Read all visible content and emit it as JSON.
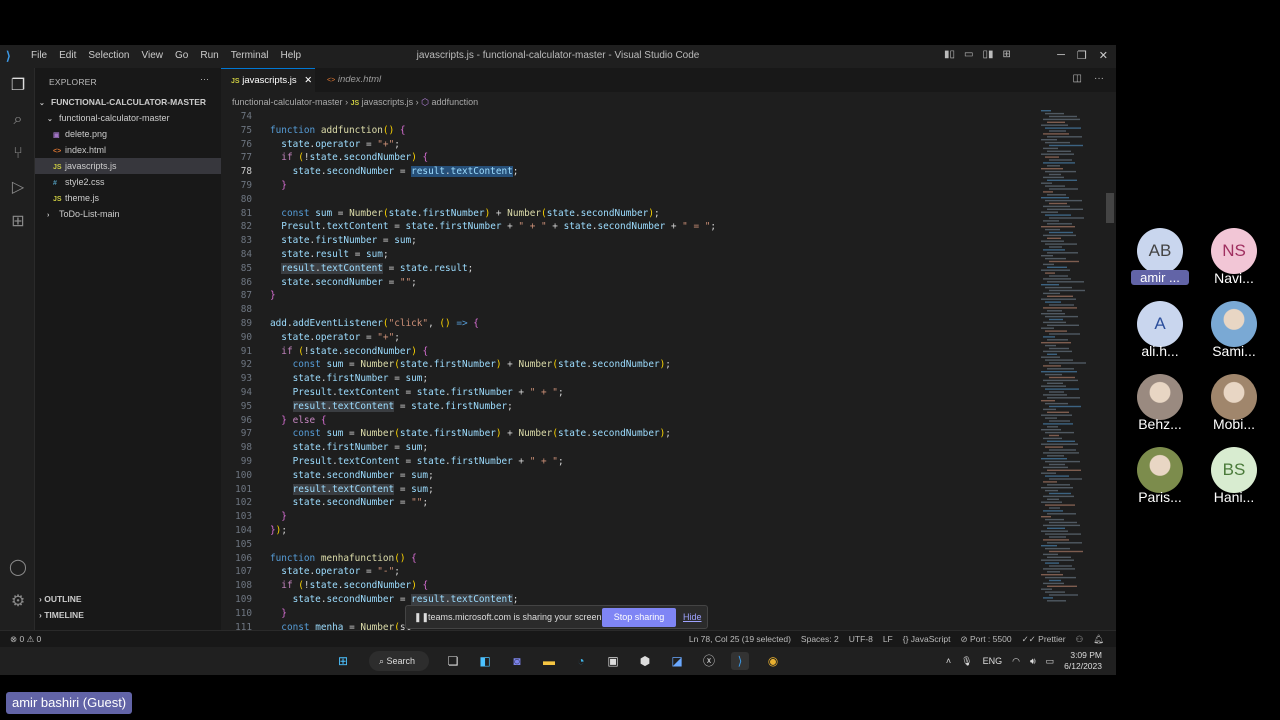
{
  "window": {
    "title": "javascripts.js - functional-calculator-master - Visual Studio Code",
    "menu": [
      "File",
      "Edit",
      "Selection",
      "View",
      "Go",
      "Run",
      "Terminal",
      "Help"
    ]
  },
  "explorer": {
    "header": "EXPLORER",
    "project": "FUNCTIONAL-CALCULATOR-MASTER",
    "folder": "functional-calculator-master",
    "files": [
      {
        "name": "delete.png",
        "type": "png",
        "badge": "▣"
      },
      {
        "name": "index.html",
        "type": "html",
        "badge": "<>"
      },
      {
        "name": "javascripts.js",
        "type": "js",
        "badge": "JS",
        "selected": true
      },
      {
        "name": "style2.css",
        "type": "css",
        "badge": "#"
      },
      {
        "name": "theme.js",
        "type": "js",
        "badge": "JS"
      }
    ],
    "other_folder": "ToDo-List-main",
    "outline": "OUTLINE",
    "timeline": "TIMELINE"
  },
  "tabs": [
    {
      "label": "javascripts.js",
      "badge": "JS",
      "active": true
    },
    {
      "label": "index.html",
      "badge": "<>",
      "active": false
    }
  ],
  "breadcrumb": {
    "folder": "functional-calculator-master",
    "file": "javascripts.js",
    "symbol": "addfunction"
  },
  "code": {
    "current_line": "78",
    "lines": [
      {
        "n": "74",
        "t": ""
      },
      {
        "n": "75",
        "t": "function addfunction() {"
      },
      {
        "n": "76",
        "t": "  state.operator = \"+\";"
      },
      {
        "n": "77",
        "t": "  if (!state.secondNumber) {"
      },
      {
        "n": "78",
        "t": "    state.secondNumber = result.textContent;"
      },
      {
        "n": "79",
        "t": "  }"
      },
      {
        "n": "80",
        "t": ""
      },
      {
        "n": "81",
        "t": "  const sum = Number(state.firstNumber) + Number(state.secondNumber);"
      },
      {
        "n": "82",
        "t": "  Presult.textContent = state.firstNumber + \" + \" + state.secondNumber + \" = \";"
      },
      {
        "n": "83",
        "t": "  state.firstNumber = sum;"
      },
      {
        "n": "84",
        "t": "  state.result = sum;"
      },
      {
        "n": "85",
        "t": "  result.textContent = state.result;"
      },
      {
        "n": "86",
        "t": "  state.secondNumber = \"\";"
      },
      {
        "n": "87",
        "t": "}"
      },
      {
        "n": "88",
        "t": ""
      },
      {
        "n": "89",
        "t": "add.addEventListener(\"click\", () => {"
      },
      {
        "n": "90",
        "t": "  state.operator = \"+\";"
      },
      {
        "n": "91",
        "t": "  if (!state.secondNumber) {"
      },
      {
        "n": "92",
        "t": "    const sum = Number(state.firstNumber) + Number(state.secondNumber);"
      },
      {
        "n": "93",
        "t": "    state.firstNumber = sum;"
      },
      {
        "n": "94",
        "t": "    Presult.textContent = state.firstNumber + \" + \";"
      },
      {
        "n": "95",
        "t": "    result.textContent = state.firstNumber;"
      },
      {
        "n": "96",
        "t": "  } else {"
      },
      {
        "n": "97",
        "t": "    const sum = Number(state.firstNumber) + Number(state.secondNumber);"
      },
      {
        "n": "98",
        "t": "    state.firstNumber = sum;"
      },
      {
        "n": "99",
        "t": "    Presult.textContent = state.firstNumber + \" + \";"
      },
      {
        "n": "100",
        "t": "    state.secondNumber = sum;"
      },
      {
        "n": "101",
        "t": "    result.textContent = sum;"
      },
      {
        "n": "102",
        "t": "    state.secondNumber = \"\";"
      },
      {
        "n": "103",
        "t": "  }"
      },
      {
        "n": "104",
        "t": "});"
      },
      {
        "n": "105",
        "t": ""
      },
      {
        "n": "106",
        "t": "function menhafunction() {"
      },
      {
        "n": "107",
        "t": "  state.operator = \"-\";"
      },
      {
        "n": "108",
        "t": "  if (!state.secondNumber) {"
      },
      {
        "n": "109",
        "t": "    state.secondNumber = result.textContent;"
      },
      {
        "n": "110",
        "t": "  }"
      },
      {
        "n": "111",
        "t": "  const menha = Number(st"
      }
    ]
  },
  "statusbar": {
    "problems": "⊗ 0 ⚠ 0",
    "items": [
      "Ln 78, Col 25 (19 selected)",
      "Spaces: 2",
      "UTF-8",
      "LF",
      "{} JavaScript",
      "⊘ Port : 5500",
      "✓✓ Prettier"
    ]
  },
  "sharebar": {
    "message": "teams.microsoft.com is sharing your screen.",
    "stop_label": "Stop sharing",
    "hide_label": "Hide"
  },
  "taskbar": {
    "search_label": "Search",
    "lang": "ENG",
    "time": "3:09 PM",
    "date": "6/12/2023"
  },
  "participants": [
    {
      "initials": "AB",
      "name": "amir ...",
      "color": "#c9d6ee",
      "text": "#444",
      "highlight": true
    },
    {
      "initials": "NS",
      "name": "Navi...",
      "color": "#f2c6d6",
      "text": "#a03060"
    },
    {
      "initials": "A",
      "name": "ali.h...",
      "color": "#c9d6ee",
      "text": "#2c4f9c"
    },
    {
      "initials": "",
      "name": "Sami...",
      "color": "#7aa9d4",
      "photo": true
    },
    {
      "initials": "",
      "name": "Behz...",
      "color": "#9a8a80",
      "photo": true
    },
    {
      "initials": "",
      "name": "Mobi...",
      "color": "#a0866c",
      "photo": true
    },
    {
      "initials": "",
      "name": "Paris...",
      "color": "#7c8c4c",
      "photo": true
    },
    {
      "initials": "BS",
      "name": "Hani...",
      "color": "#d8ecd0",
      "text": "#4a7a3a"
    }
  ],
  "guest_label": "amir bashiri (Guest)",
  "colors": {
    "accent": "#0078d4",
    "teams": "#6264a7",
    "selection": "#264f78"
  }
}
